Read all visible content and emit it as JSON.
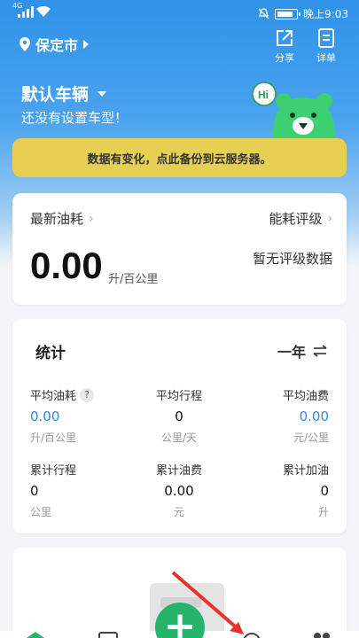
{
  "status_bar": {
    "network": "4G",
    "time": "晚上9:03"
  },
  "header": {
    "city": "保定市",
    "share_label": "分享",
    "detail_label": "详单"
  },
  "vehicle": {
    "name": "默认车辆",
    "subtitle": "还没有设置车型！",
    "mascot_bubble": "Hi"
  },
  "notice": {
    "text": "数据有变化，点此备份到云服务器。"
  },
  "consumption_card": {
    "latest_label": "最新油耗",
    "rating_label": "能耗评级",
    "value": "0.00",
    "unit": "升/百公里",
    "rating_value": "暂无评级数据"
  },
  "stats_card": {
    "title": "统计",
    "period": "一年",
    "items": [
      {
        "label": "平均油耗",
        "value": "0.00",
        "unit": "升/百公里",
        "highlight": true,
        "help": "?"
      },
      {
        "label": "平均行程",
        "value": "0",
        "unit": "公里/天",
        "highlight": false
      },
      {
        "label": "平均油费",
        "value": "0.00",
        "unit": "元/公里",
        "highlight": true
      },
      {
        "label": "累计行程",
        "value": "0",
        "unit": "公里",
        "highlight": false
      },
      {
        "label": "累计油费",
        "value": "0.00",
        "unit": "元",
        "highlight": false
      },
      {
        "label": "累计加油",
        "value": "0",
        "unit": "升",
        "highlight": false
      }
    ]
  },
  "fab": {
    "label": "+"
  },
  "colors": {
    "primary_blue": "#2f92e8",
    "accent_green": "#26b46a",
    "notice_yellow": "#e6cf52",
    "value_blue": "#2d8ae0",
    "arrow_red": "#e8322b"
  }
}
